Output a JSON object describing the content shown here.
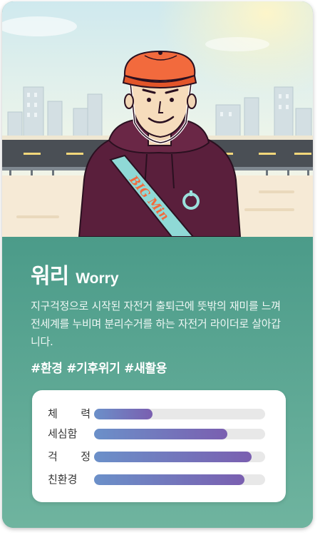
{
  "character": {
    "name_ko": "워리",
    "name_en": "Worry",
    "description": "지구걱정으로 시작된 자전거 출퇴근에 뜻밖의 재미를 느껴 전세계를 누비며 분리수거를 하는 자전거 라이더로 살아갑니다.",
    "tags": "#환경 #기후위기 #새활용",
    "sash_text": "BIG Min"
  },
  "stats": [
    {
      "label": "체 력",
      "value": 0.34
    },
    {
      "label": "세심함",
      "value": 0.78
    },
    {
      "label": "걱 정",
      "value": 0.92
    },
    {
      "label": "친환경",
      "value": 0.88
    }
  ],
  "colors": {
    "info_bg": "#4b9b89",
    "bar_start": "#6b90c9",
    "bar_end": "#7a5fb0",
    "hoodie": "#5a1f3c",
    "cap": "#f26a3d",
    "sash": "#8fd9d6"
  }
}
